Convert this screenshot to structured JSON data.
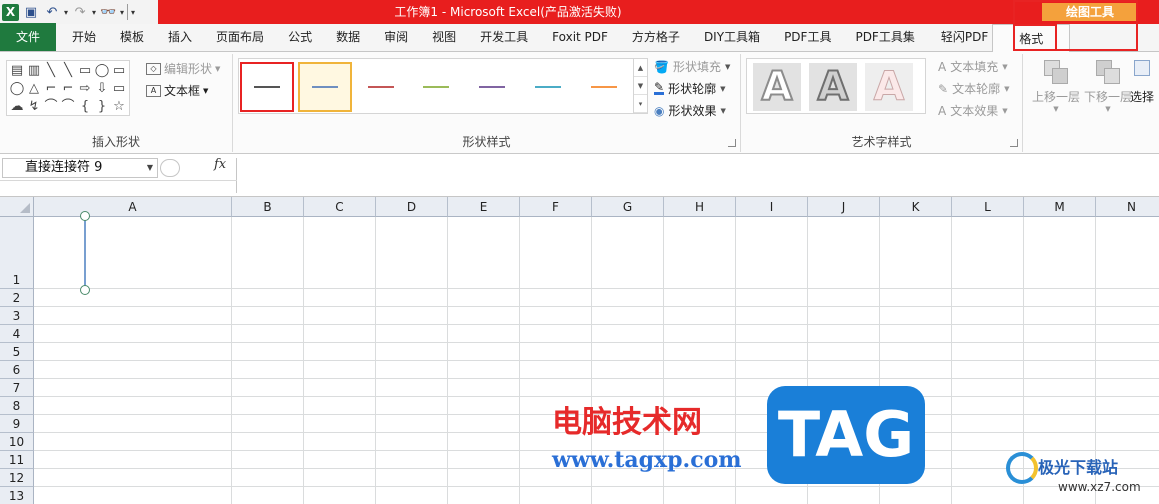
{
  "titlebar": {
    "title": "工作簿1 - Microsoft Excel(产品激活失败)",
    "app_icon": "X",
    "save_icon": "▣",
    "undo_icon": "↶",
    "redo_icon": "↷",
    "find_icon": "👓",
    "context_group": "绘图工具"
  },
  "tabs": [
    "文件",
    "开始",
    "模板",
    "插入",
    "页面布局",
    "公式",
    "数据",
    "审阅",
    "视图",
    "开发工具",
    "Foxit PDF",
    "方方格子",
    "DIY工具箱",
    "PDF工具",
    "PDF工具集",
    "轻闪PDF",
    "格式"
  ],
  "ribbon": {
    "insert_shapes": {
      "label": "插入形状",
      "edit_shape": "编辑形状",
      "text_box": "文本框",
      "glyphs": [
        "▤",
        "▥",
        "╲",
        "╲",
        "▭",
        "◯",
        "▭",
        "◯",
        "△",
        "⌐",
        "⌐",
        "⇨",
        "⇩",
        "▭",
        "☁",
        "↯",
        "⌒",
        "⌒",
        "{",
        "}",
        "☆"
      ]
    },
    "shape_styles": {
      "label": "形状样式",
      "line_colors": [
        "#555555",
        "#6f8fc0",
        "#c45656",
        "#9bbb59",
        "#8064a2",
        "#4bacc6",
        "#f79646"
      ],
      "fill": "形状填充",
      "outline": "形状轮廓",
      "effects": "形状效果"
    },
    "wordart_styles": {
      "label": "艺术字样式",
      "letters": [
        "A",
        "A",
        "A"
      ],
      "text_fill": "文本填充",
      "text_outline": "文本轮廓",
      "text_effects": "文本效果"
    },
    "arrange": {
      "bring_forward": "上移一层",
      "send_backward": "下移一层",
      "selection": "选择"
    }
  },
  "formula_bar": {
    "name_box": "直接连接符 9",
    "fx": "fx",
    "value": ""
  },
  "grid": {
    "columns": [
      "A",
      "B",
      "C",
      "D",
      "E",
      "F",
      "G",
      "H",
      "I",
      "J",
      "K",
      "L",
      "M",
      "N"
    ],
    "rows": [
      "1",
      "2",
      "3",
      "4",
      "5",
      "6",
      "7",
      "8",
      "9",
      "10",
      "11",
      "12",
      "13"
    ]
  },
  "watermark": {
    "site_name": "电脑技术网",
    "site_url": "www.tagxp.com",
    "tag": "TAG",
    "jg_name": "极光下载站",
    "jg_url": "www.xz7.com"
  }
}
